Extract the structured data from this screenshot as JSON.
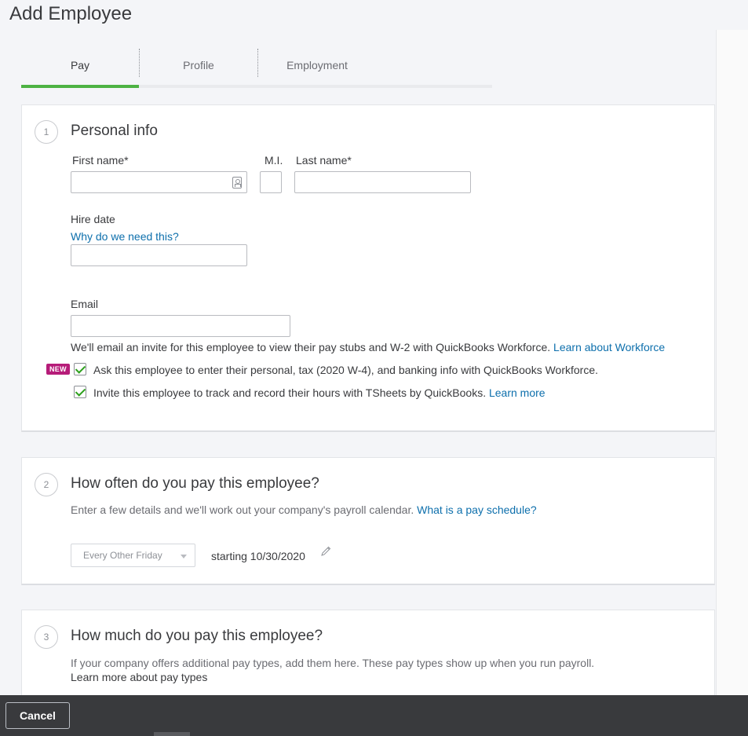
{
  "page": {
    "title": "Add Employee"
  },
  "tabs": [
    {
      "label": "Pay",
      "active": true
    },
    {
      "label": "Profile",
      "active": false
    },
    {
      "label": "Employment",
      "active": false
    }
  ],
  "section1": {
    "step": "1",
    "title": "Personal info",
    "first_name_label": "First name*",
    "mi_label": "M.I.",
    "last_name_label": "Last name*",
    "first_name_value": "",
    "mi_value": "",
    "last_name_value": "",
    "hire_date_label": "Hire date",
    "hire_date_help": "Why do we need this?",
    "hire_date_value": "",
    "email_label": "Email",
    "email_value": "",
    "email_note": "We'll email an invite for this employee to view their pay stubs and W-2 with QuickBooks Workforce.",
    "email_note_link": "Learn about Workforce",
    "badge": "NEW",
    "checkbox1_label": "Ask this employee to enter their personal, tax (2020 W-4), and banking info with QuickBooks Workforce.",
    "checkbox1_checked": true,
    "checkbox2_label": "Invite this employee to track and record their hours with TSheets by QuickBooks.",
    "checkbox2_link": "Learn more",
    "checkbox2_checked": true
  },
  "section2": {
    "step": "2",
    "title": "How often do you pay this employee?",
    "desc": "Enter a few details and we'll work out your company's payroll calendar.",
    "desc_link": "What is a pay schedule?",
    "schedule_selected": "Every Other Friday",
    "starting_text": "starting 10/30/2020"
  },
  "section3": {
    "step": "3",
    "title": "How much do you pay this employee?",
    "desc": "If your company offers additional pay types, add them here. These pay types show up when you run payroll.",
    "desc_link": "Learn more about pay types"
  },
  "footer": {
    "cancel_label": "Cancel"
  },
  "colors": {
    "accent_green": "#4db243",
    "link_blue": "#0d6fac",
    "badge_magenta": "#b61c79",
    "footer_bg": "#393a3d"
  }
}
